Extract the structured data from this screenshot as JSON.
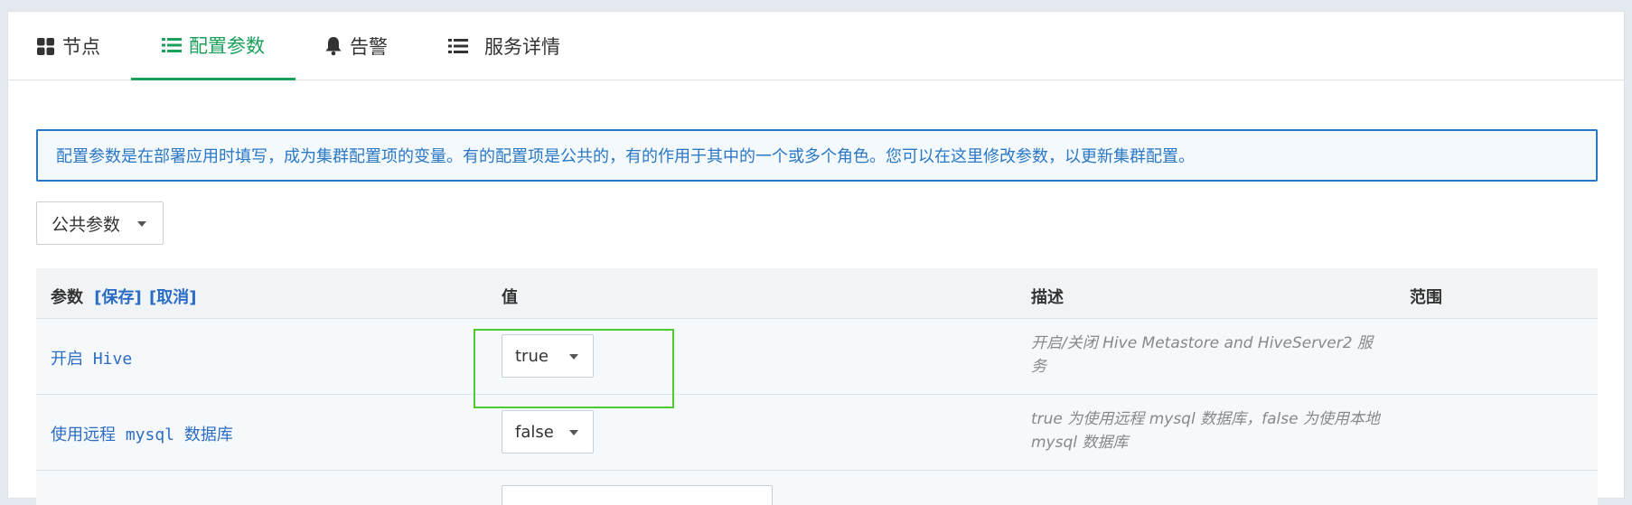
{
  "tabs": [
    {
      "label": "节点",
      "icon": "grid-icon"
    },
    {
      "label": "配置参数",
      "icon": "list-icon",
      "active": true
    },
    {
      "label": "告警",
      "icon": "bell-icon"
    },
    {
      "label": "服务详情",
      "icon": "list-icon"
    }
  ],
  "info_message": "配置参数是在部署应用时填写，成为集群配置项的变量。有的配置项是公共的，有的作用于其中的一个或多个角色。您可以在这里修改参数，以更新集群配置。",
  "scope_select": {
    "value": "公共参数"
  },
  "table": {
    "headers": {
      "param": "参数",
      "save": "[保存]",
      "cancel": "[取消]",
      "value": "值",
      "description": "描述",
      "scope": "范围"
    },
    "rows": [
      {
        "name": "开启 Hive",
        "value": "true",
        "description": "开启/关闭 Hive Metastore and HiveServer2 服务"
      },
      {
        "name": "使用远程 mysql 数据库",
        "value": "false",
        "description": "true 为使用远程 mysql 数据库，false 为使用本地 mysql 数据库"
      }
    ]
  },
  "colors": {
    "accent": "#1aa05a",
    "link": "#2b6cc4",
    "info": "#2b78c5",
    "highlight": "#4ccd2e"
  }
}
